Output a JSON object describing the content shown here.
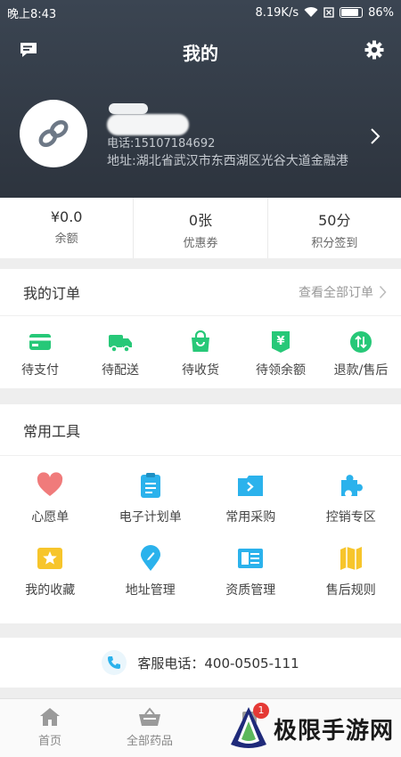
{
  "status_bar": {
    "time": "晚上8:43",
    "speed": "8.19K/s",
    "battery": "86%"
  },
  "header": {
    "title": "我的"
  },
  "profile": {
    "phone": "电话:15107184692",
    "address": "地址:湖北省武汉市东西湖区光谷大道金融港"
  },
  "stats": [
    {
      "value": "¥0.0",
      "label": "余额"
    },
    {
      "value": "0张",
      "label": "优惠券"
    },
    {
      "value": "50分",
      "label": "积分签到"
    }
  ],
  "orders": {
    "title": "我的订单",
    "view_all": "查看全部订单",
    "items": [
      {
        "label": "待支付",
        "icon": "card-icon"
      },
      {
        "label": "待配送",
        "icon": "truck-icon"
      },
      {
        "label": "待收货",
        "icon": "bag-icon"
      },
      {
        "label": "待领余额",
        "icon": "yen-tag-icon"
      },
      {
        "label": "退款/售后",
        "icon": "refund-icon"
      }
    ]
  },
  "tools": {
    "title": "常用工具",
    "items": [
      {
        "label": "心愿单",
        "icon": "heart-icon"
      },
      {
        "label": "电子计划单",
        "icon": "clipboard-icon"
      },
      {
        "label": "常用采购",
        "icon": "folder-icon"
      },
      {
        "label": "控销专区",
        "icon": "puzzle-icon"
      },
      {
        "label": "我的收藏",
        "icon": "star-icon"
      },
      {
        "label": "地址管理",
        "icon": "location-pin-icon"
      },
      {
        "label": "资质管理",
        "icon": "document-icon"
      },
      {
        "label": "售后规则",
        "icon": "map-icon"
      }
    ]
  },
  "service": {
    "text": "客服电话：400-0505-111"
  },
  "bottom_nav": {
    "items": [
      {
        "label": "首页",
        "icon": "home-icon"
      },
      {
        "label": "全部药品",
        "icon": "basket-icon"
      }
    ],
    "cart_badge": "1"
  },
  "watermark": {
    "text": "极限手游网"
  },
  "colors": {
    "header_bg": "#2f3742",
    "accent_green": "#27c878",
    "accent_blue": "#2bb2ec",
    "heart_red": "#f07b7b",
    "star_yellow": "#f7c52b",
    "badge_red": "#e53935"
  }
}
